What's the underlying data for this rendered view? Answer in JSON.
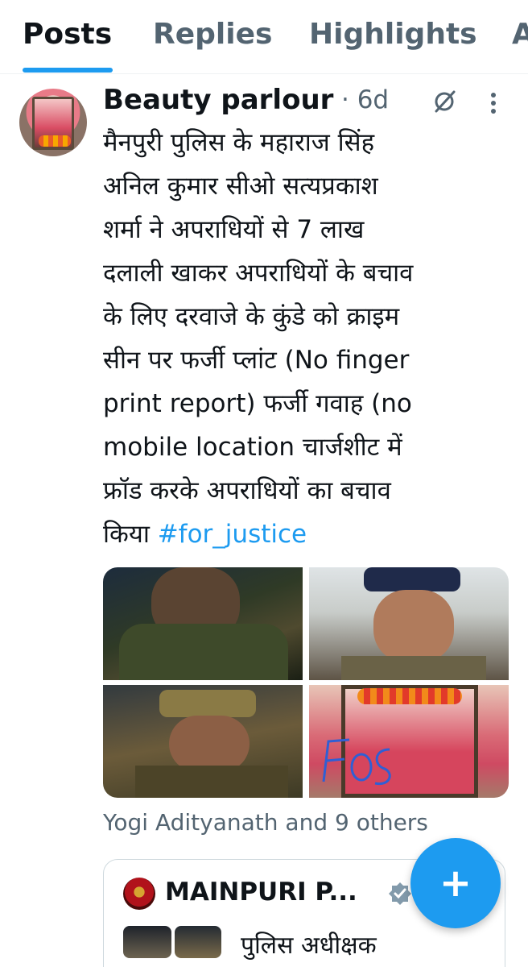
{
  "tabs": [
    {
      "label": "Posts",
      "active": true
    },
    {
      "label": "Replies",
      "active": false
    },
    {
      "label": "Highlights",
      "active": false
    },
    {
      "label": "A",
      "active": false
    }
  ],
  "post": {
    "author": "Beauty parlour",
    "time": "· 6d",
    "icons": [
      "grok-icon",
      "more-vertical-icon"
    ],
    "text_lines": [
      "मैनपुरी पुलिस के महाराज सिंह",
      "अनिल कुमार सीओ सत्यप्रकाश",
      "शर्मा ने अपराधियों से 7 लाख",
      "दलाली खाकर अपराधियों के बचाव",
      "के लिए दरवाजे के कुंडे को क्राइम",
      "सीन पर फर्जी प्लांट (No finger",
      "print report) फर्जी गवाह (no",
      "mobile location चार्जशीट में",
      "फ्रॉड करके अपराधियों का बचाव"
    ],
    "last_line_prefix": "किया ",
    "hashtag": "#for_justice",
    "likes_text": "Yogi Adityanath and 9 others"
  },
  "quote": {
    "name": "MAINPURI P...",
    "text": "पुलिस अधीक्षक"
  },
  "fab": {
    "label": "+"
  },
  "colors": {
    "accent": "#1d9bf0",
    "text": "#0f1419",
    "muted": "#536471"
  }
}
